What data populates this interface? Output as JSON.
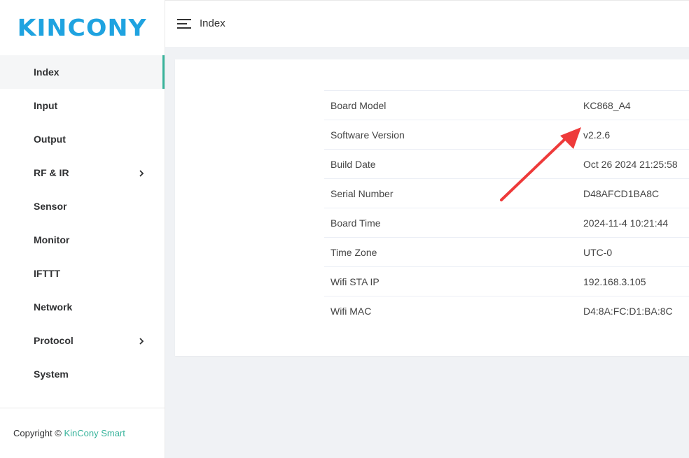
{
  "app": {
    "logo": "KINCONY"
  },
  "sidebar": {
    "items": [
      {
        "label": "Index",
        "active": true,
        "has_submenu": false
      },
      {
        "label": "Input",
        "active": false,
        "has_submenu": false
      },
      {
        "label": "Output",
        "active": false,
        "has_submenu": false
      },
      {
        "label": "RF & IR",
        "active": false,
        "has_submenu": true
      },
      {
        "label": "Sensor",
        "active": false,
        "has_submenu": false
      },
      {
        "label": "Monitor",
        "active": false,
        "has_submenu": false
      },
      {
        "label": "IFTTT",
        "active": false,
        "has_submenu": false
      },
      {
        "label": "Network",
        "active": false,
        "has_submenu": false
      },
      {
        "label": "Protocol",
        "active": false,
        "has_submenu": true
      },
      {
        "label": "System",
        "active": false,
        "has_submenu": false
      }
    ],
    "copyright_prefix": "Copyright ©",
    "copyright_brand": "KinCony Smart"
  },
  "header": {
    "menu_icon": "hamburger-icon",
    "title": "Index"
  },
  "info": {
    "rows": [
      {
        "key": "Board Model",
        "value": "KC868_A4"
      },
      {
        "key": "Software Version",
        "value": "v2.2.6"
      },
      {
        "key": "Build Date",
        "value": "Oct 26 2024 21:25:58"
      },
      {
        "key": "Serial Number",
        "value": "D48AFCD1BA8C"
      },
      {
        "key": "Board Time",
        "value": "2024-11-4 10:21:44"
      },
      {
        "key": "Time Zone",
        "value": "UTC-0"
      },
      {
        "key": "Wifi STA IP",
        "value": "192.168.3.105"
      },
      {
        "key": "Wifi MAC",
        "value": "D4:8A:FC:D1:BA:8C"
      }
    ]
  },
  "colors": {
    "logo": "#1fa3e0",
    "accent": "#37b39b",
    "annotation_arrow": "#ee3a3a",
    "background": "#f0f2f5"
  }
}
